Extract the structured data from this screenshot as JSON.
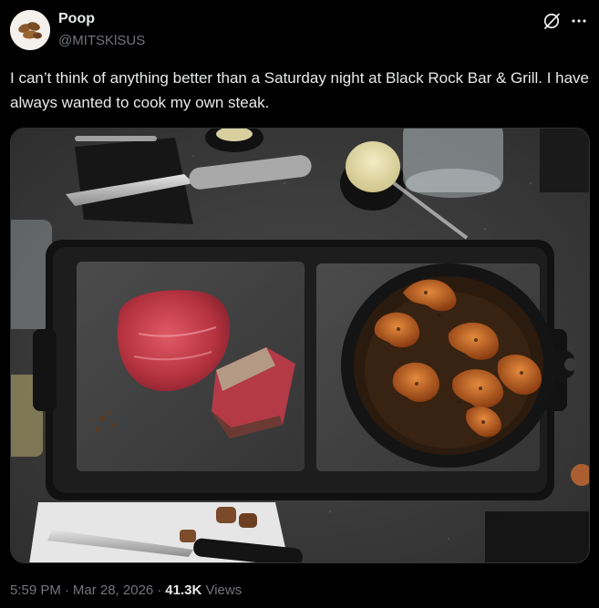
{
  "author": {
    "display_name": "Poop",
    "handle": "@MITSKlSUS",
    "avatar_icon": "avatar-food-image"
  },
  "actions": {
    "grok_icon": "grok-slash-circle-icon",
    "more_icon": "more-dots-icon"
  },
  "tweet": {
    "text": "I can’t think of anything better than a Saturday night at Black Rock Bar & Grill. I have always wanted to cook my own steak."
  },
  "media": {
    "type": "photo",
    "subject": "stone-cooked-steak-and-shrimp-skillet"
  },
  "meta": {
    "time": "5:59 PM",
    "dot": "·",
    "date": "Mar 28, 2026",
    "views_count": "41.3K",
    "views_label": "Views"
  },
  "colors": {
    "background": "#000000",
    "primary_text": "#e7e9ea",
    "secondary_text": "#71767b",
    "border": "#2f3336"
  }
}
